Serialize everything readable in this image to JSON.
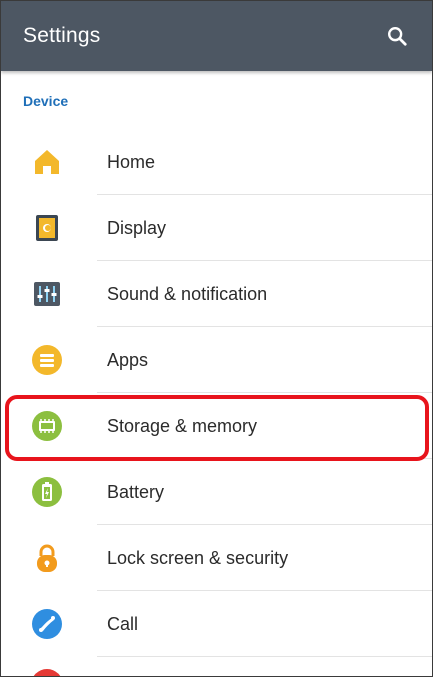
{
  "appbar": {
    "title": "Settings",
    "search_icon": "search-icon"
  },
  "section": {
    "title": "Device"
  },
  "items": [
    {
      "label": "Home",
      "icon": "home-icon",
      "color": "#f3b82b"
    },
    {
      "label": "Display",
      "icon": "display-icon",
      "color": "#f3b82b"
    },
    {
      "label": "Sound & notification",
      "icon": "sound-icon",
      "color": "#4d5763"
    },
    {
      "label": "Apps",
      "icon": "apps-icon",
      "color": "#f3b82b"
    },
    {
      "label": "Storage & memory",
      "icon": "storage-icon",
      "color": "#8cbf3f"
    },
    {
      "label": "Battery",
      "icon": "battery-icon",
      "color": "#8cbf3f"
    },
    {
      "label": "Lock screen & security",
      "icon": "lock-icon",
      "color": "#f29b1d"
    },
    {
      "label": "Call",
      "icon": "call-icon",
      "color": "#2f8ee0"
    }
  ],
  "colors": {
    "appbar": "#4d5763",
    "section_header": "#1f6fb8",
    "highlight": "#e8141c"
  }
}
